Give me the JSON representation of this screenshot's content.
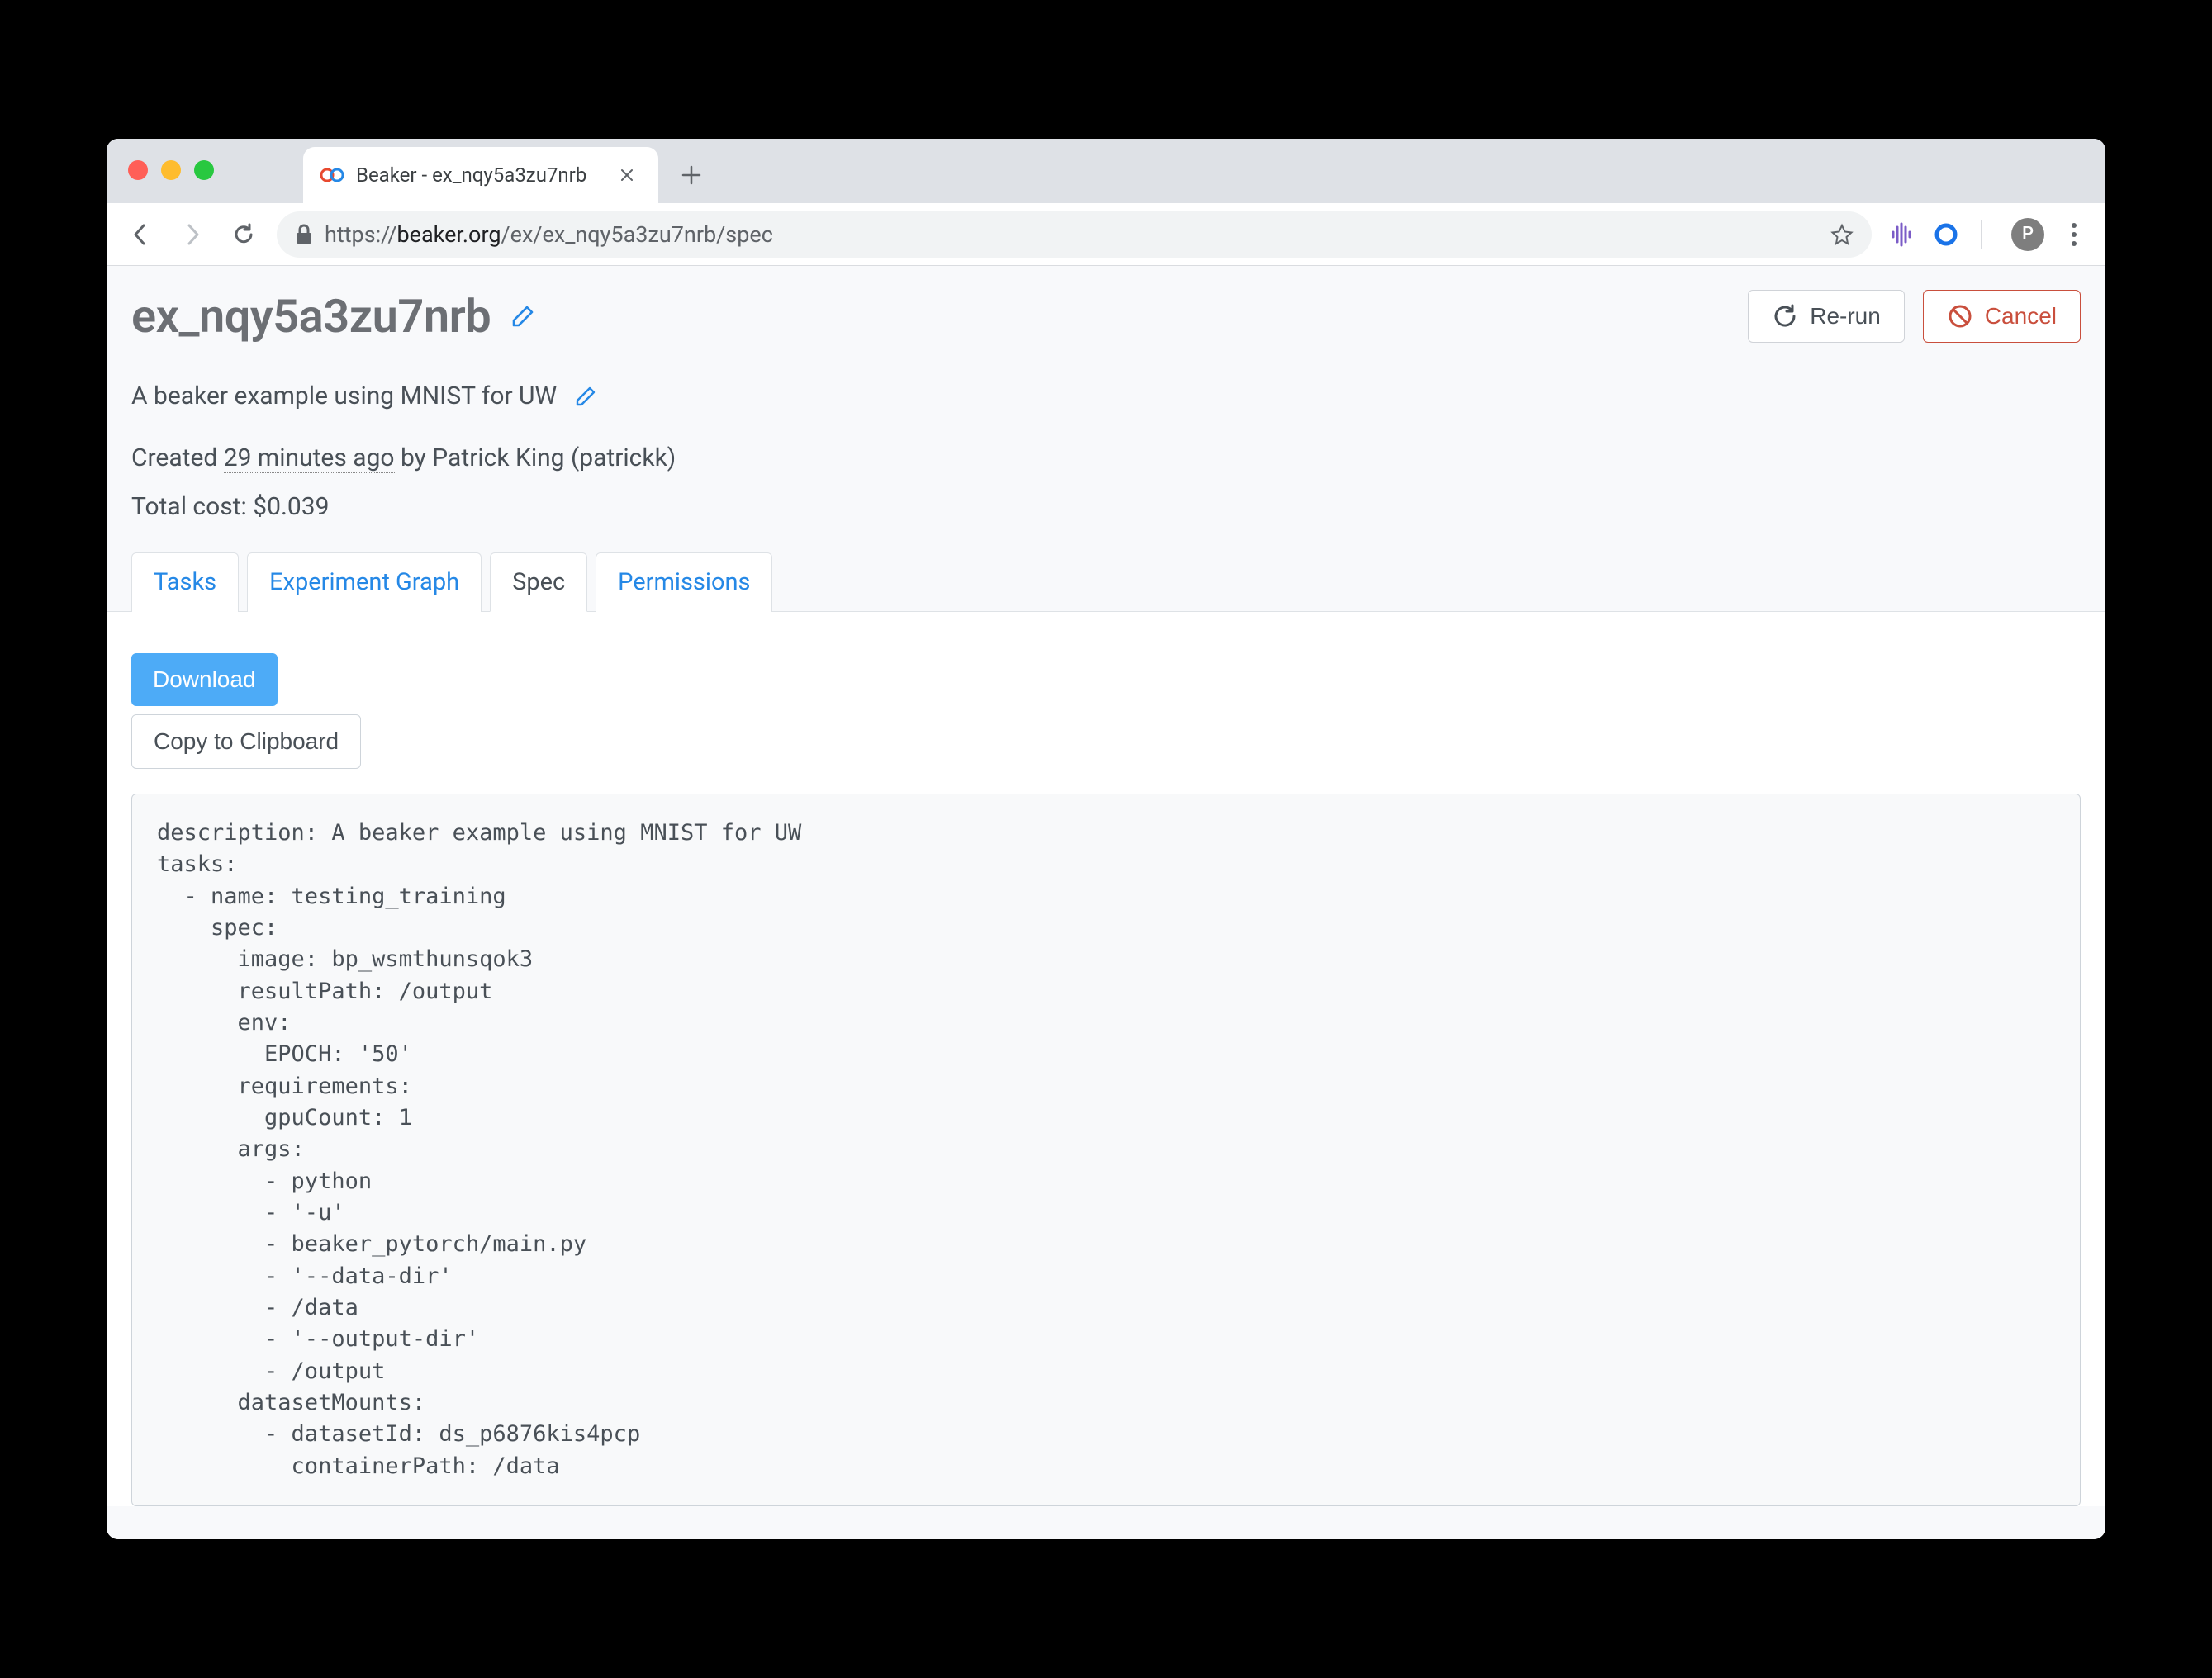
{
  "browser": {
    "tab_title": "Beaker - ex_nqy5a3zu7nrb",
    "url_host": "beaker.org",
    "url_prefix": "https://",
    "url_path": "/ex/ex_nqy5a3zu7nrb/spec",
    "profile_initial": "P"
  },
  "header": {
    "title": "ex_nqy5a3zu7nrb",
    "rerun_label": "Re-run",
    "cancel_label": "Cancel"
  },
  "description": "A beaker example using MNIST for UW",
  "meta": {
    "created_prefix": "Created ",
    "created_ago": "29 minutes ago",
    "created_by": " by Patrick King (patrickk)",
    "cost_label": "Total cost: ",
    "cost_value": "$0.039"
  },
  "tabs": {
    "tasks": "Tasks",
    "graph": "Experiment Graph",
    "spec": "Spec",
    "permissions": "Permissions"
  },
  "buttons": {
    "download": "Download",
    "copy": "Copy to Clipboard"
  },
  "spec_text": "description: A beaker example using MNIST for UW\ntasks:\n  - name: testing_training\n    spec:\n      image: bp_wsmthunsqok3\n      resultPath: /output\n      env:\n        EPOCH: '50'\n      requirements:\n        gpuCount: 1\n      args:\n        - python\n        - '-u'\n        - beaker_pytorch/main.py\n        - '--data-dir'\n        - /data\n        - '--output-dir'\n        - /output\n      datasetMounts:\n        - datasetId: ds_p6876kis4pcp\n          containerPath: /data"
}
